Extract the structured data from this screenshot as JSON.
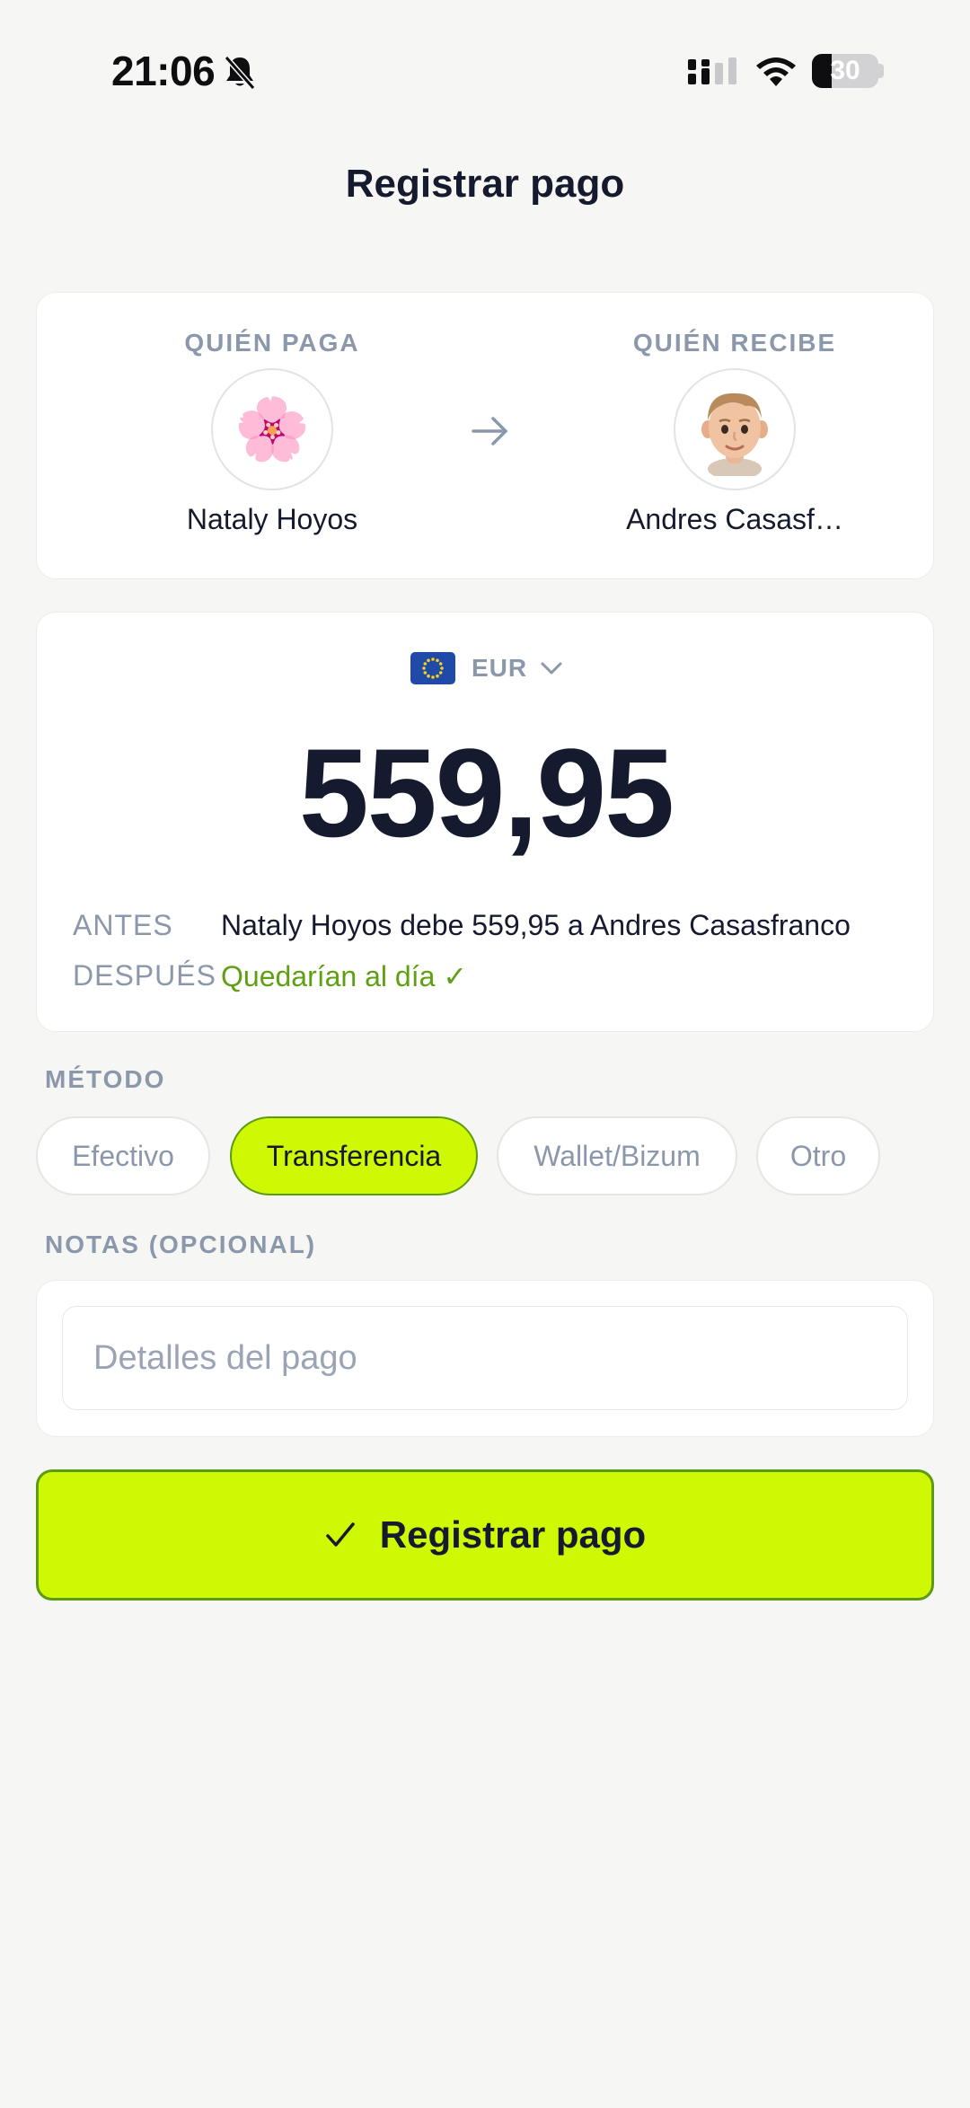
{
  "status_bar": {
    "time": "21:06",
    "battery_level": "30",
    "icons": [
      "bell-slash-icon",
      "signal-icon",
      "wifi-icon",
      "battery-icon"
    ]
  },
  "header": {
    "title": "Registrar pago"
  },
  "payer": {
    "label": "QUIÉN PAGA",
    "name": "Nataly Hoyos",
    "avatar": "🌸"
  },
  "receiver": {
    "label": "QUIÉN RECIBE",
    "name": "Andres Casasf…",
    "avatar": "🧑🏼"
  },
  "amount_card": {
    "currency_flag": "🇪🇺",
    "currency_code": "EUR",
    "amount": "559,95",
    "before_label": "ANTES",
    "before_text": "Nataly Hoyos debe 559,95 a Andres Casasfranco",
    "after_label": "DESPUÉS",
    "after_text": "Quedarían al día ✓"
  },
  "method": {
    "label": "MÉTODO",
    "options": [
      "Efectivo",
      "Transferencia",
      "Wallet/Bizum",
      "Otro"
    ],
    "selected": "Transferencia"
  },
  "notes": {
    "label": "NOTAS (OPCIONAL)",
    "placeholder": "Detalles del pago",
    "value": ""
  },
  "submit": {
    "label": "Registrar pago"
  },
  "colors": {
    "accent": "#cef804",
    "accent_border": "#5d9a14",
    "success_text": "#5fa012",
    "muted_text": "#8b97aa",
    "primary_text": "#151a2e"
  }
}
